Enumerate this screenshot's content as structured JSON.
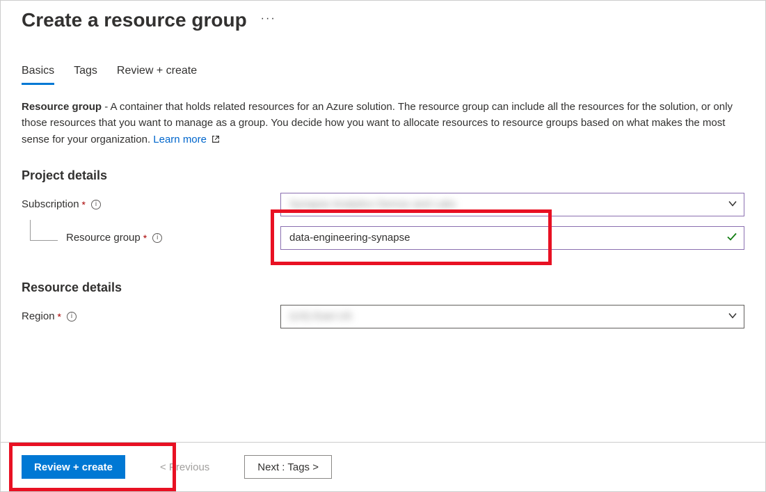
{
  "header": {
    "title": "Create a resource group",
    "ellipsis": "···"
  },
  "tabs": [
    {
      "label": "Basics",
      "active": true
    },
    {
      "label": "Tags",
      "active": false
    },
    {
      "label": "Review + create",
      "active": false
    }
  ],
  "description": {
    "bold": "Resource group",
    "text": " - A container that holds related resources for an Azure solution. The resource group can include all the resources for the solution, or only those resources that you want to manage as a group. You decide how you want to allocate resources to resource groups based on what makes the most sense for your organization. ",
    "link": "Learn more"
  },
  "sections": {
    "project": {
      "title": "Project details",
      "subscription_label": "Subscription",
      "subscription_value": "Synapse Analytics Demos and Labs",
      "rg_label": "Resource group",
      "rg_value": "data-engineering-synapse"
    },
    "resource": {
      "title": "Resource details",
      "region_label": "Region",
      "region_value": "(US) East US"
    }
  },
  "footer": {
    "review": "Review + create",
    "previous": "< Previous",
    "next": "Next : Tags >"
  }
}
